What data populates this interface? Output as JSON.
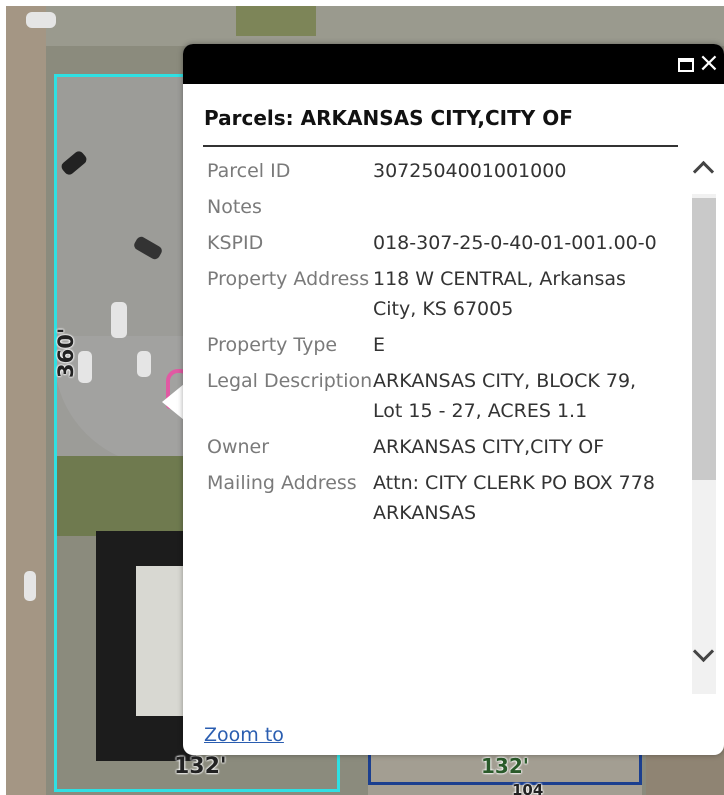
{
  "map": {
    "dimension_labels": {
      "left": "360'",
      "bottom_left": "132'",
      "bottom_right": "132'",
      "bottom_right_small": "104"
    }
  },
  "popup": {
    "title": "Parcels: ARKANSAS CITY,CITY OF",
    "close_icon": "×",
    "attributes": [
      {
        "label": "Parcel ID",
        "value": "3072504001001000"
      },
      {
        "label": "Notes",
        "value": ""
      },
      {
        "label": "KSPID",
        "value": "018-307-25-0-40-01-001.00-0"
      },
      {
        "label": "Property Address",
        "value": "118 W CENTRAL, Arkansas City, KS 67005"
      },
      {
        "label": "Property Type",
        "value": "E"
      },
      {
        "label": "Legal Description",
        "value": "ARKANSAS CITY, BLOCK 79, Lot 15 - 27, ACRES 1.1"
      },
      {
        "label": "Owner",
        "value": "ARKANSAS CITY,CITY OF"
      },
      {
        "label": "Mailing Address",
        "value": "Attn: CITY CLERK PO BOX 778 ARKANSAS"
      }
    ],
    "zoom_link": "Zoom to"
  },
  "colors": {
    "parcel_outline": "#2fe0e3",
    "adjacent_outline": "#1b3f8f",
    "titlebar": "#000000",
    "link": "#2a5db0"
  }
}
